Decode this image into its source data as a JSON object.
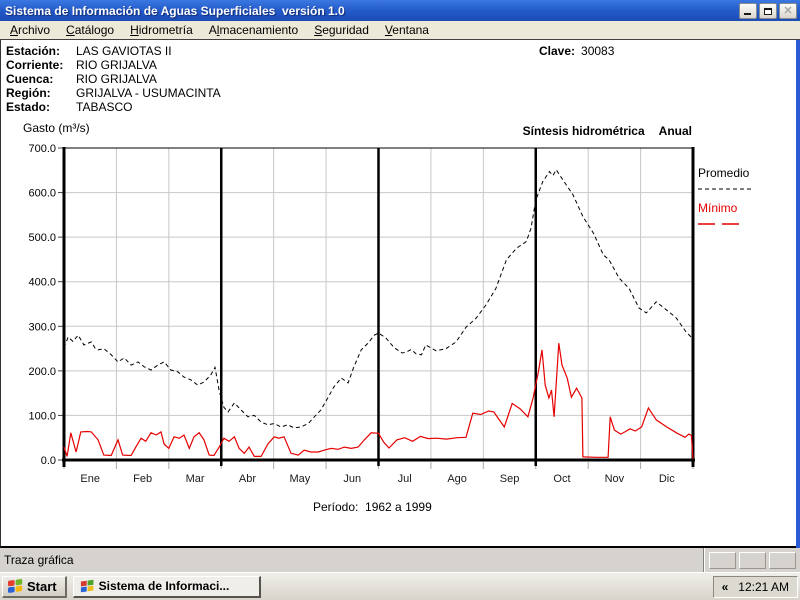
{
  "window": {
    "title": "Sistema de Información de Aguas Superficiales  versión 1.0"
  },
  "menu": {
    "items": [
      {
        "label": "Archivo",
        "underline": 0
      },
      {
        "label": "Catálogo",
        "underline": 0
      },
      {
        "label": "Hidrometría",
        "underline": 0
      },
      {
        "label": "Almacenamiento",
        "underline": 1
      },
      {
        "label": "Seguridad",
        "underline": 0
      },
      {
        "label": "Ventana",
        "underline": 0
      }
    ]
  },
  "station": {
    "rows": [
      {
        "label": "Estación:",
        "value": "LAS GAVIOTAS II"
      },
      {
        "label": "Corriente:",
        "value": "RIO GRIJALVA"
      },
      {
        "label": "Cuenca:",
        "value": "RIO GRIJALVA"
      },
      {
        "label": "Región:",
        "value": "GRIJALVA - USUMACINTA"
      },
      {
        "label": "Estado:",
        "value": "TABASCO"
      }
    ],
    "clave_label": "Clave:",
    "clave_value": "30083"
  },
  "chart_header": {
    "title": "Síntesis hidrométrica",
    "mode": "Anual"
  },
  "legend": {
    "promedio": "Promedio",
    "minimo": "Mínimo"
  },
  "chart_data": {
    "type": "line",
    "title": "Síntesis hidrométrica Anual",
    "ylabel": "Gasto (m³/s)",
    "caption": "Período:  1962 a 1999",
    "categories": [
      "Ene",
      "Feb",
      "Mar",
      "Abr",
      "May",
      "Jun",
      "Jul",
      "Ago",
      "Sep",
      "Oct",
      "Nov",
      "Dic"
    ],
    "ylim": [
      0,
      700
    ],
    "yticks": [
      0,
      100,
      200,
      300,
      400,
      500,
      600,
      700
    ],
    "x_unit": "months 0-12 (fraction of year)",
    "grid": true,
    "legend_position": "top-right-outside",
    "quarter_lines_months": [
      3,
      6,
      9
    ],
    "colors": {
      "promedio": "#000000",
      "minimo": "#e60000",
      "grid": "#c8c8c8"
    },
    "series": [
      {
        "name": "Promedio",
        "style": "dashed",
        "color": "#000000",
        "points": [
          [
            0,
            252
          ],
          [
            0.08,
            276
          ],
          [
            0.17,
            266
          ],
          [
            0.27,
            280
          ],
          [
            0.38,
            258
          ],
          [
            0.52,
            265
          ],
          [
            0.6,
            250
          ],
          [
            0.65,
            247
          ],
          [
            0.76,
            250
          ],
          [
            0.9,
            236
          ],
          [
            1.03,
            220
          ],
          [
            1.15,
            229
          ],
          [
            1.28,
            213
          ],
          [
            1.41,
            220
          ],
          [
            1.53,
            209
          ],
          [
            1.66,
            202
          ],
          [
            1.79,
            213
          ],
          [
            1.91,
            220
          ],
          [
            2.04,
            202
          ],
          [
            2.17,
            198
          ],
          [
            2.29,
            186
          ],
          [
            2.42,
            180
          ],
          [
            2.55,
            168
          ],
          [
            2.67,
            175
          ],
          [
            2.8,
            191
          ],
          [
            2.88,
            208
          ],
          [
            2.96,
            155
          ],
          [
            3.05,
            118
          ],
          [
            3.13,
            108
          ],
          [
            3.25,
            128
          ],
          [
            3.38,
            112
          ],
          [
            3.51,
            97
          ],
          [
            3.63,
            100
          ],
          [
            3.76,
            85
          ],
          [
            3.89,
            79
          ],
          [
            4.01,
            82
          ],
          [
            4.14,
            74
          ],
          [
            4.27,
            79
          ],
          [
            4.39,
            72
          ],
          [
            4.52,
            74
          ],
          [
            4.66,
            82
          ],
          [
            4.77,
            96
          ],
          [
            4.9,
            112
          ],
          [
            5.04,
            141
          ],
          [
            5.15,
            164
          ],
          [
            5.29,
            184
          ],
          [
            5.42,
            173
          ],
          [
            5.53,
            209
          ],
          [
            5.67,
            247
          ],
          [
            5.8,
            262
          ],
          [
            5.92,
            280
          ],
          [
            6,
            285
          ],
          [
            6.14,
            274
          ],
          [
            6.3,
            252
          ],
          [
            6.45,
            240
          ],
          [
            6.53,
            242
          ],
          [
            6.62,
            248
          ],
          [
            6.72,
            238
          ],
          [
            6.82,
            236
          ],
          [
            6.9,
            258
          ],
          [
            7.1,
            245
          ],
          [
            7.29,
            250
          ],
          [
            7.48,
            265
          ],
          [
            7.67,
            298
          ],
          [
            7.86,
            318
          ],
          [
            8.05,
            348
          ],
          [
            8.24,
            385
          ],
          [
            8.44,
            449
          ],
          [
            8.63,
            475
          ],
          [
            8.82,
            490
          ],
          [
            8.91,
            520
          ],
          [
            9,
            583
          ],
          [
            9.13,
            624
          ],
          [
            9.26,
            647
          ],
          [
            9.33,
            638
          ],
          [
            9.39,
            651
          ],
          [
            9.52,
            628
          ],
          [
            9.71,
            595
          ],
          [
            9.9,
            546
          ],
          [
            10.1,
            509
          ],
          [
            10.29,
            460
          ],
          [
            10.4,
            449
          ],
          [
            10.59,
            408
          ],
          [
            10.78,
            385
          ],
          [
            10.97,
            341
          ],
          [
            11.11,
            330
          ],
          [
            11.3,
            355
          ],
          [
            11.49,
            337
          ],
          [
            11.68,
            319
          ],
          [
            11.87,
            287
          ],
          [
            12,
            272
          ]
        ]
      },
      {
        "name": "Mínimo",
        "style": "solid",
        "color": "#e60000",
        "points": [
          [
            0,
            29
          ],
          [
            0.06,
            8
          ],
          [
            0.13,
            61
          ],
          [
            0.23,
            18
          ],
          [
            0.32,
            63
          ],
          [
            0.45,
            64
          ],
          [
            0.52,
            63
          ],
          [
            0.65,
            45
          ],
          [
            0.76,
            11
          ],
          [
            0.9,
            10
          ],
          [
            1.03,
            45
          ],
          [
            1.12,
            11
          ],
          [
            1.28,
            10
          ],
          [
            1.37,
            29
          ],
          [
            1.47,
            49
          ],
          [
            1.56,
            42
          ],
          [
            1.66,
            61
          ],
          [
            1.76,
            56
          ],
          [
            1.85,
            63
          ],
          [
            1.91,
            36
          ],
          [
            2,
            26
          ],
          [
            2.1,
            52
          ],
          [
            2.2,
            49
          ],
          [
            2.29,
            56
          ],
          [
            2.39,
            26
          ],
          [
            2.48,
            52
          ],
          [
            2.58,
            61
          ],
          [
            2.67,
            45
          ],
          [
            2.77,
            11
          ],
          [
            2.86,
            10
          ],
          [
            2.96,
            29
          ],
          [
            3.05,
            49
          ],
          [
            3.15,
            42
          ],
          [
            3.25,
            52
          ],
          [
            3.34,
            26
          ],
          [
            3.44,
            15
          ],
          [
            3.53,
            29
          ],
          [
            3.63,
            8
          ],
          [
            3.76,
            8
          ],
          [
            3.89,
            36
          ],
          [
            4.01,
            52
          ],
          [
            4.1,
            49
          ],
          [
            4.2,
            52
          ],
          [
            4.33,
            15
          ],
          [
            4.47,
            11
          ],
          [
            4.58,
            22
          ],
          [
            4.71,
            18
          ],
          [
            4.85,
            18
          ],
          [
            4.96,
            22
          ],
          [
            5.1,
            26
          ],
          [
            5.23,
            24
          ],
          [
            5.35,
            29
          ],
          [
            5.48,
            26
          ],
          [
            5.61,
            29
          ],
          [
            5.73,
            45
          ],
          [
            5.86,
            61
          ],
          [
            6,
            60
          ],
          [
            6.1,
            40
          ],
          [
            6.2,
            27
          ],
          [
            6.35,
            45
          ],
          [
            6.5,
            50
          ],
          [
            6.65,
            42
          ],
          [
            6.8,
            53
          ],
          [
            6.95,
            48
          ],
          [
            7.1,
            49
          ],
          [
            7.3,
            47
          ],
          [
            7.5,
            50
          ],
          [
            7.67,
            51
          ],
          [
            7.8,
            105
          ],
          [
            7.95,
            102
          ],
          [
            8.1,
            110
          ],
          [
            8.2,
            108
          ],
          [
            8.4,
            74
          ],
          [
            8.55,
            127
          ],
          [
            8.7,
            115
          ],
          [
            8.85,
            97
          ],
          [
            8.95,
            139
          ],
          [
            9.05,
            198
          ],
          [
            9.12,
            247
          ],
          [
            9.18,
            168
          ],
          [
            9.25,
            139
          ],
          [
            9.3,
            157
          ],
          [
            9.35,
            97
          ],
          [
            9.44,
            262
          ],
          [
            9.5,
            213
          ],
          [
            9.6,
            184
          ],
          [
            9.68,
            141
          ],
          [
            9.78,
            161
          ],
          [
            9.88,
            139
          ],
          [
            9.9,
            7
          ],
          [
            10.15,
            6
          ],
          [
            10.38,
            6
          ],
          [
            10.42,
            97
          ],
          [
            10.5,
            67
          ],
          [
            10.62,
            58
          ],
          [
            10.7,
            63
          ],
          [
            10.8,
            70
          ],
          [
            10.9,
            65
          ],
          [
            11.02,
            74
          ],
          [
            11.15,
            117
          ],
          [
            11.3,
            90
          ],
          [
            11.5,
            74
          ],
          [
            11.7,
            60
          ],
          [
            11.85,
            51
          ],
          [
            11.92,
            58
          ],
          [
            11.97,
            55
          ],
          [
            12,
            3
          ]
        ]
      }
    ]
  },
  "statusbar": {
    "text": "Traza gráfica"
  },
  "taskbar": {
    "start_label": "Start",
    "task_label": "Sistema de Informaci...",
    "tray_chevron": "«",
    "clock": "12:21 AM"
  }
}
